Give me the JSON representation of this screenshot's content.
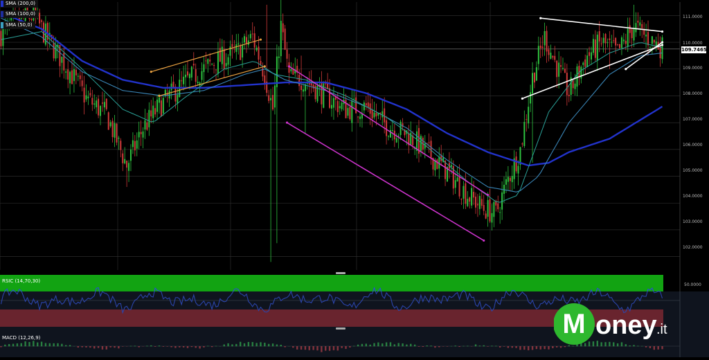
{
  "legend": [
    {
      "label": "SMA (200,0)",
      "color": "#2233cc"
    },
    {
      "label": "SMA (100,0)",
      "color": "#1d2d9e"
    },
    {
      "label": "SMA (50,0)",
      "color": "#3aa0c0"
    }
  ],
  "price_axis": {
    "ticks": [
      "111.0000",
      "110.0000",
      "109.0000",
      "108.0000",
      "107.0000",
      "106.0000",
      "105.0000",
      "104.0000",
      "103.0000",
      "102.0000"
    ],
    "current_price": "109.7465"
  },
  "rsi_panel": {
    "label": "RSIC (14,70,30)",
    "level_tick": "50.0000"
  },
  "macd_panel": {
    "label": "MACD (12,26,9)"
  },
  "logo": {
    "letter": "M",
    "word": "oney",
    "suffix": ".it"
  },
  "colors": {
    "background": "#000000",
    "grid": "#333333",
    "candle_up": "#2ec23f",
    "candle_down": "#d23a3a",
    "sma200": "#2233cc",
    "sma100": "#3a86b8",
    "sma50": "#2aa198",
    "channel_orange": "#e8a040",
    "channel_magenta": "#cc33cc",
    "triangle_white": "#ffffff",
    "rsi_green": "#12a312",
    "rsi_red": "#8a1a1a",
    "rsi_line": "#2b4bd8",
    "logo_green": "#2eb82e",
    "logo_overlay": "#2c3a55"
  },
  "chart_data": {
    "type": "candlestick",
    "title": "",
    "ylim": [
      101.5,
      111.5
    ],
    "y_ticks": [
      111,
      110,
      109,
      108,
      107,
      106,
      105,
      104,
      103,
      102
    ],
    "current_price": 109.7465,
    "anchor_closes": [
      [
        0,
        110.3
      ],
      [
        8,
        110.8
      ],
      [
        16,
        111.0
      ],
      [
        24,
        110.0
      ],
      [
        34,
        108.9
      ],
      [
        42,
        107.9
      ],
      [
        52,
        107.3
      ],
      [
        62,
        105.4
      ],
      [
        70,
        106.8
      ],
      [
        78,
        107.6
      ],
      [
        86,
        108.2
      ],
      [
        96,
        108.8
      ],
      [
        106,
        109.3
      ],
      [
        116,
        109.6
      ],
      [
        124,
        110.2
      ],
      [
        130,
        108.8
      ],
      [
        134,
        107.5
      ],
      [
        138,
        110.6
      ],
      [
        142,
        108.7
      ],
      [
        150,
        108.6
      ],
      [
        160,
        108.0
      ],
      [
        170,
        107.5
      ],
      [
        180,
        107.6
      ],
      [
        190,
        106.9
      ],
      [
        200,
        106.6
      ],
      [
        210,
        105.9
      ],
      [
        220,
        105.2
      ],
      [
        230,
        104.3
      ],
      [
        238,
        103.8
      ],
      [
        244,
        103.6
      ],
      [
        250,
        104.9
      ],
      [
        256,
        106.0
      ],
      [
        262,
        108.7
      ],
      [
        268,
        110.2
      ],
      [
        274,
        109.1
      ],
      [
        280,
        108.1
      ],
      [
        288,
        109.4
      ],
      [
        296,
        110.0
      ],
      [
        304,
        109.6
      ],
      [
        312,
        110.6
      ],
      [
        318,
        110.2
      ],
      [
        326,
        109.8
      ]
    ],
    "series": [
      {
        "id": "sma200",
        "anchors": [
          [
            0,
            111.1
          ],
          [
            20,
            110.5
          ],
          [
            40,
            109.3
          ],
          [
            60,
            108.6
          ],
          [
            80,
            108.3
          ],
          [
            100,
            108.3
          ],
          [
            120,
            108.4
          ],
          [
            140,
            108.5
          ],
          [
            160,
            108.5
          ],
          [
            180,
            108.1
          ],
          [
            200,
            107.5
          ],
          [
            220,
            106.6
          ],
          [
            240,
            105.9
          ],
          [
            260,
            105.4
          ],
          [
            270,
            105.5
          ],
          [
            280,
            105.9
          ],
          [
            300,
            106.4
          ],
          [
            326,
            107.6
          ]
        ]
      },
      {
        "id": "sma100",
        "anchors": [
          [
            0,
            110.9
          ],
          [
            20,
            110.2
          ],
          [
            40,
            108.9
          ],
          [
            60,
            108.2
          ],
          [
            80,
            108.0
          ],
          [
            100,
            108.2
          ],
          [
            120,
            108.8
          ],
          [
            130,
            109.0
          ],
          [
            140,
            108.6
          ],
          [
            160,
            108.2
          ],
          [
            180,
            107.6
          ],
          [
            200,
            106.8
          ],
          [
            220,
            105.6
          ],
          [
            240,
            104.6
          ],
          [
            255,
            104.4
          ],
          [
            265,
            105.0
          ],
          [
            280,
            107.0
          ],
          [
            300,
            108.8
          ],
          [
            315,
            109.5
          ],
          [
            326,
            109.6
          ]
        ]
      },
      {
        "id": "sma50",
        "anchors": [
          [
            0,
            110.1
          ],
          [
            20,
            110.4
          ],
          [
            40,
            109.0
          ],
          [
            60,
            107.5
          ],
          [
            75,
            107.0
          ],
          [
            90,
            107.9
          ],
          [
            110,
            109.0
          ],
          [
            125,
            109.3
          ],
          [
            135,
            108.8
          ],
          [
            150,
            108.6
          ],
          [
            170,
            108.0
          ],
          [
            190,
            107.2
          ],
          [
            210,
            106.1
          ],
          [
            230,
            104.8
          ],
          [
            245,
            104.0
          ],
          [
            255,
            104.3
          ],
          [
            270,
            107.4
          ],
          [
            285,
            108.9
          ],
          [
            300,
            109.6
          ],
          [
            315,
            110.0
          ],
          [
            326,
            109.8
          ]
        ]
      }
    ],
    "trendlines": [
      {
        "id": "orange-channel-upper",
        "color": "channel_orange",
        "p1": [
          74,
          108.9
        ],
        "p2": [
          128,
          110.1
        ]
      },
      {
        "id": "orange-channel-lower",
        "color": "channel_orange",
        "p1": [
          78,
          108.0
        ],
        "p2": [
          130,
          109.1
        ]
      },
      {
        "id": "magenta-channel-upper",
        "color": "channel_magenta",
        "p1": [
          142,
          109.1
        ],
        "p2": [
          240,
          104.3
        ]
      },
      {
        "id": "magenta-channel-lower",
        "color": "channel_magenta",
        "p1": [
          141,
          107.0
        ],
        "p2": [
          238,
          102.6
        ]
      },
      {
        "id": "triangle-upper",
        "color": "triangle_white",
        "p1": [
          266,
          110.9
        ],
        "p2": [
          326,
          110.4
        ]
      },
      {
        "id": "triangle-lower",
        "color": "triangle_white",
        "p1": [
          257,
          107.9
        ],
        "p2": [
          326,
          109.9
        ]
      },
      {
        "id": "triangle-inner",
        "color": "triangle_white",
        "p1": [
          308,
          109.0
        ],
        "p2": [
          326,
          110.0
        ]
      }
    ],
    "rsi": {
      "level": 50,
      "overbought": 70,
      "oversold": 30
    },
    "macd": {
      "fast": 12,
      "slow": 26,
      "signal": 9
    }
  }
}
